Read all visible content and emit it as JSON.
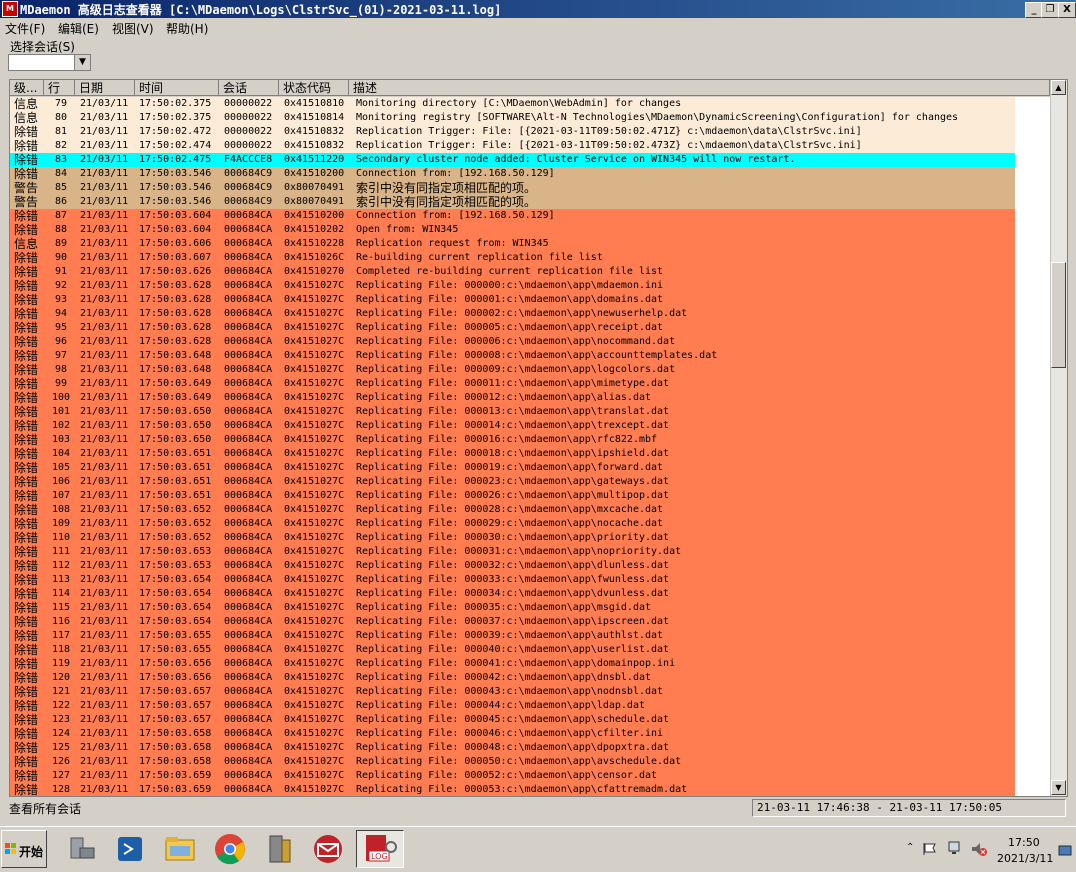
{
  "window": {
    "title": "MDaemon 高级日志查看器 [C:\\MDaemon\\Logs\\ClstrSvc_(01)-2021-03-11.log]",
    "icon": "mdaemon-logo-icon",
    "min_glyph": "_",
    "max_glyph": "❐",
    "close_glyph": "X"
  },
  "menu": {
    "file": "文件(F)",
    "edit": "编辑(E)",
    "view": "视图(V)",
    "help": "帮助(H)"
  },
  "session": {
    "label": "选择会话(S)",
    "value": ""
  },
  "columns": {
    "level": "级...",
    "line": "行",
    "date": "日期",
    "time": "时间",
    "session": "会话",
    "status": "状态代码",
    "desc": "描述"
  },
  "colors": {
    "info": "#fbebd7",
    "highlight": "#00ffff",
    "tan": "#d8b488",
    "error": "#ff7d50"
  },
  "rows": [
    [
      "信息",
      "79",
      "21/03/11",
      "17:50:02.375",
      "00000022",
      "0x41510810",
      "Monitoring directory [C:\\MDaemon\\WebAdmin] for changes",
      "info"
    ],
    [
      "信息",
      "80",
      "21/03/11",
      "17:50:02.375",
      "00000022",
      "0x41510814",
      "Monitoring registry [SOFTWARE\\Alt-N Technologies\\MDaemon\\DynamicScreening\\Configuration] for changes",
      "info"
    ],
    [
      "除错",
      "81",
      "21/03/11",
      "17:50:02.472",
      "00000022",
      "0x41510832",
      "Replication Trigger: File: [{2021-03-11T09:50:02.471Z} c:\\mdaemon\\data\\ClstrSvc.ini]",
      "info"
    ],
    [
      "除错",
      "82",
      "21/03/11",
      "17:50:02.474",
      "00000022",
      "0x41510832",
      "Replication Trigger: File: [{2021-03-11T09:50:02.473Z} c:\\mdaemon\\data\\ClstrSvc.ini]",
      "info"
    ],
    [
      "除错",
      "83",
      "21/03/11",
      "17:50:02.475",
      "F4ACCCE8",
      "0x41511220",
      "Secondary cluster node added: Cluster Service on WIN345 will now restart.",
      "highlight"
    ],
    [
      "除错",
      "84",
      "21/03/11",
      "17:50:03.546",
      "000684C9",
      "0x41510200",
      "Connection from: [192.168.50.129]",
      "tan"
    ],
    [
      "警告",
      "85",
      "21/03/11",
      "17:50:03.546",
      "000684C9",
      "0x80070491",
      "索引中没有同指定项相匹配的项。",
      "tan"
    ],
    [
      "警告",
      "86",
      "21/03/11",
      "17:50:03.546",
      "000684C9",
      "0x80070491",
      "索引中没有同指定项相匹配的项。",
      "tan"
    ],
    [
      "除错",
      "87",
      "21/03/11",
      "17:50:03.604",
      "000684CA",
      "0x41510200",
      "Connection from: [192.168.50.129]",
      "error"
    ],
    [
      "除错",
      "88",
      "21/03/11",
      "17:50:03.604",
      "000684CA",
      "0x41510202",
      "Open from: WIN345",
      "error"
    ],
    [
      "信息",
      "89",
      "21/03/11",
      "17:50:03.606",
      "000684CA",
      "0x41510228",
      "Replication request from: WIN345",
      "error"
    ],
    [
      "除错",
      "90",
      "21/03/11",
      "17:50:03.607",
      "000684CA",
      "0x4151026C",
      "Re-building current replication file list",
      "error"
    ],
    [
      "除错",
      "91",
      "21/03/11",
      "17:50:03.626",
      "000684CA",
      "0x41510270",
      "Completed re-building current replication file list",
      "error"
    ],
    [
      "除错",
      "92",
      "21/03/11",
      "17:50:03.628",
      "000684CA",
      "0x4151027C",
      "Replicating File: 000000:c:\\mdaemon\\app\\mdaemon.ini",
      "error"
    ],
    [
      "除错",
      "93",
      "21/03/11",
      "17:50:03.628",
      "000684CA",
      "0x4151027C",
      "Replicating File: 000001:c:\\mdaemon\\app\\domains.dat",
      "error"
    ],
    [
      "除错",
      "94",
      "21/03/11",
      "17:50:03.628",
      "000684CA",
      "0x4151027C",
      "Replicating File: 000002:c:\\mdaemon\\app\\newuserhelp.dat",
      "error"
    ],
    [
      "除错",
      "95",
      "21/03/11",
      "17:50:03.628",
      "000684CA",
      "0x4151027C",
      "Replicating File: 000005:c:\\mdaemon\\app\\receipt.dat",
      "error"
    ],
    [
      "除错",
      "96",
      "21/03/11",
      "17:50:03.628",
      "000684CA",
      "0x4151027C",
      "Replicating File: 000006:c:\\mdaemon\\app\\nocommand.dat",
      "error"
    ],
    [
      "除错",
      "97",
      "21/03/11",
      "17:50:03.648",
      "000684CA",
      "0x4151027C",
      "Replicating File: 000008:c:\\mdaemon\\app\\accounttemplates.dat",
      "error"
    ],
    [
      "除错",
      "98",
      "21/03/11",
      "17:50:03.648",
      "000684CA",
      "0x4151027C",
      "Replicating File: 000009:c:\\mdaemon\\app\\logcolors.dat",
      "error"
    ],
    [
      "除错",
      "99",
      "21/03/11",
      "17:50:03.649",
      "000684CA",
      "0x4151027C",
      "Replicating File: 000011:c:\\mdaemon\\app\\mimetype.dat",
      "error"
    ],
    [
      "除错",
      "100",
      "21/03/11",
      "17:50:03.649",
      "000684CA",
      "0x4151027C",
      "Replicating File: 000012:c:\\mdaemon\\app\\alias.dat",
      "error"
    ],
    [
      "除错",
      "101",
      "21/03/11",
      "17:50:03.650",
      "000684CA",
      "0x4151027C",
      "Replicating File: 000013:c:\\mdaemon\\app\\translat.dat",
      "error"
    ],
    [
      "除错",
      "102",
      "21/03/11",
      "17:50:03.650",
      "000684CA",
      "0x4151027C",
      "Replicating File: 000014:c:\\mdaemon\\app\\trexcept.dat",
      "error"
    ],
    [
      "除错",
      "103",
      "21/03/11",
      "17:50:03.650",
      "000684CA",
      "0x4151027C",
      "Replicating File: 000016:c:\\mdaemon\\app\\rfc822.mbf",
      "error"
    ],
    [
      "除错",
      "104",
      "21/03/11",
      "17:50:03.651",
      "000684CA",
      "0x4151027C",
      "Replicating File: 000018:c:\\mdaemon\\app\\ipshield.dat",
      "error"
    ],
    [
      "除错",
      "105",
      "21/03/11",
      "17:50:03.651",
      "000684CA",
      "0x4151027C",
      "Replicating File: 000019:c:\\mdaemon\\app\\forward.dat",
      "error"
    ],
    [
      "除错",
      "106",
      "21/03/11",
      "17:50:03.651",
      "000684CA",
      "0x4151027C",
      "Replicating File: 000023:c:\\mdaemon\\app\\gateways.dat",
      "error"
    ],
    [
      "除错",
      "107",
      "21/03/11",
      "17:50:03.651",
      "000684CA",
      "0x4151027C",
      "Replicating File: 000026:c:\\mdaemon\\app\\multipop.dat",
      "error"
    ],
    [
      "除错",
      "108",
      "21/03/11",
      "17:50:03.652",
      "000684CA",
      "0x4151027C",
      "Replicating File: 000028:c:\\mdaemon\\app\\mxcache.dat",
      "error"
    ],
    [
      "除错",
      "109",
      "21/03/11",
      "17:50:03.652",
      "000684CA",
      "0x4151027C",
      "Replicating File: 000029:c:\\mdaemon\\app\\nocache.dat",
      "error"
    ],
    [
      "除错",
      "110",
      "21/03/11",
      "17:50:03.652",
      "000684CA",
      "0x4151027C",
      "Replicating File: 000030:c:\\mdaemon\\app\\priority.dat",
      "error"
    ],
    [
      "除错",
      "111",
      "21/03/11",
      "17:50:03.653",
      "000684CA",
      "0x4151027C",
      "Replicating File: 000031:c:\\mdaemon\\app\\nopriority.dat",
      "error"
    ],
    [
      "除错",
      "112",
      "21/03/11",
      "17:50:03.653",
      "000684CA",
      "0x4151027C",
      "Replicating File: 000032:c:\\mdaemon\\app\\dlunless.dat",
      "error"
    ],
    [
      "除错",
      "113",
      "21/03/11",
      "17:50:03.654",
      "000684CA",
      "0x4151027C",
      "Replicating File: 000033:c:\\mdaemon\\app\\fwunless.dat",
      "error"
    ],
    [
      "除错",
      "114",
      "21/03/11",
      "17:50:03.654",
      "000684CA",
      "0x4151027C",
      "Replicating File: 000034:c:\\mdaemon\\app\\dvunless.dat",
      "error"
    ],
    [
      "除错",
      "115",
      "21/03/11",
      "17:50:03.654",
      "000684CA",
      "0x4151027C",
      "Replicating File: 000035:c:\\mdaemon\\app\\msgid.dat",
      "error"
    ],
    [
      "除错",
      "116",
      "21/03/11",
      "17:50:03.654",
      "000684CA",
      "0x4151027C",
      "Replicating File: 000037:c:\\mdaemon\\app\\ipscreen.dat",
      "error"
    ],
    [
      "除错",
      "117",
      "21/03/11",
      "17:50:03.655",
      "000684CA",
      "0x4151027C",
      "Replicating File: 000039:c:\\mdaemon\\app\\authlst.dat",
      "error"
    ],
    [
      "除错",
      "118",
      "21/03/11",
      "17:50:03.655",
      "000684CA",
      "0x4151027C",
      "Replicating File: 000040:c:\\mdaemon\\app\\userlist.dat",
      "error"
    ],
    [
      "除错",
      "119",
      "21/03/11",
      "17:50:03.656",
      "000684CA",
      "0x4151027C",
      "Replicating File: 000041:c:\\mdaemon\\app\\domainpop.ini",
      "error"
    ],
    [
      "除错",
      "120",
      "21/03/11",
      "17:50:03.656",
      "000684CA",
      "0x4151027C",
      "Replicating File: 000042:c:\\mdaemon\\app\\dnsbl.dat",
      "error"
    ],
    [
      "除错",
      "121",
      "21/03/11",
      "17:50:03.657",
      "000684CA",
      "0x4151027C",
      "Replicating File: 000043:c:\\mdaemon\\app\\nodnsbl.dat",
      "error"
    ],
    [
      "除错",
      "122",
      "21/03/11",
      "17:50:03.657",
      "000684CA",
      "0x4151027C",
      "Replicating File: 000044:c:\\mdaemon\\app\\ldap.dat",
      "error"
    ],
    [
      "除错",
      "123",
      "21/03/11",
      "17:50:03.657",
      "000684CA",
      "0x4151027C",
      "Replicating File: 000045:c:\\mdaemon\\app\\schedule.dat",
      "error"
    ],
    [
      "除错",
      "124",
      "21/03/11",
      "17:50:03.658",
      "000684CA",
      "0x4151027C",
      "Replicating File: 000046:c:\\mdaemon\\app\\cfilter.ini",
      "error"
    ],
    [
      "除错",
      "125",
      "21/03/11",
      "17:50:03.658",
      "000684CA",
      "0x4151027C",
      "Replicating File: 000048:c:\\mdaemon\\app\\dpopxtra.dat",
      "error"
    ],
    [
      "除错",
      "126",
      "21/03/11",
      "17:50:03.658",
      "000684CA",
      "0x4151027C",
      "Replicating File: 000050:c:\\mdaemon\\app\\avschedule.dat",
      "error"
    ],
    [
      "除错",
      "127",
      "21/03/11",
      "17:50:03.659",
      "000684CA",
      "0x4151027C",
      "Replicating File: 000052:c:\\mdaemon\\app\\censor.dat",
      "error"
    ],
    [
      "除错",
      "128",
      "21/03/11",
      "17:50:03.659",
      "000684CA",
      "0x4151027C",
      "Replicating File: 000053:c:\\mdaemon\\app\\cfattremadm.dat",
      "error"
    ]
  ],
  "status": {
    "left": "查看所有会话",
    "range": "21-03-11 17:46:38 - 21-03-11 17:50:05"
  },
  "taskbar": {
    "start": "开始",
    "apps": [
      "server-manager-icon",
      "powershell-icon",
      "file-explorer-icon",
      "chrome-icon",
      "tools-icon",
      "mdaemon-icon",
      "log-viewer-icon"
    ],
    "time": "17:50",
    "date": "2021/3/11"
  }
}
